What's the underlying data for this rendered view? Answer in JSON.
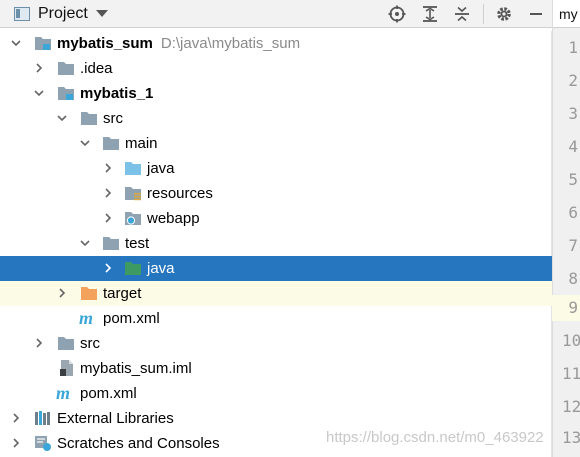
{
  "header": {
    "title": "Project",
    "editor_tab": "my"
  },
  "tree": [
    {
      "label": "mybatis_sum",
      "path": "D:\\java\\mybatis_sum",
      "bold": true
    },
    {
      "label": ".idea"
    },
    {
      "label": "mybatis_1",
      "bold": true
    },
    {
      "label": "src"
    },
    {
      "label": "main"
    },
    {
      "label": "java"
    },
    {
      "label": "resources"
    },
    {
      "label": "webapp"
    },
    {
      "label": "test"
    },
    {
      "label": "java"
    },
    {
      "label": "target"
    },
    {
      "label": "pom.xml"
    },
    {
      "label": "src"
    },
    {
      "label": "mybatis_sum.iml"
    },
    {
      "label": "pom.xml"
    },
    {
      "label": "External Libraries"
    },
    {
      "label": "Scratches and Consoles"
    }
  ],
  "line_numbers": [
    "1",
    "2",
    "3",
    "4",
    "5",
    "6",
    "7",
    "8",
    "9",
    "10",
    "11",
    "12",
    "13"
  ],
  "watermark": "https://blog.csdn.net/m0_463922",
  "colors": {
    "selection": "#2675bf",
    "current_line": "#fbfbe6",
    "folder": "#8fa2b1",
    "source_folder": "#7cc1e8",
    "test_source_folder": "#3e9a63",
    "excluded_folder": "#f3a25c",
    "maven": "#3aa7d8"
  }
}
